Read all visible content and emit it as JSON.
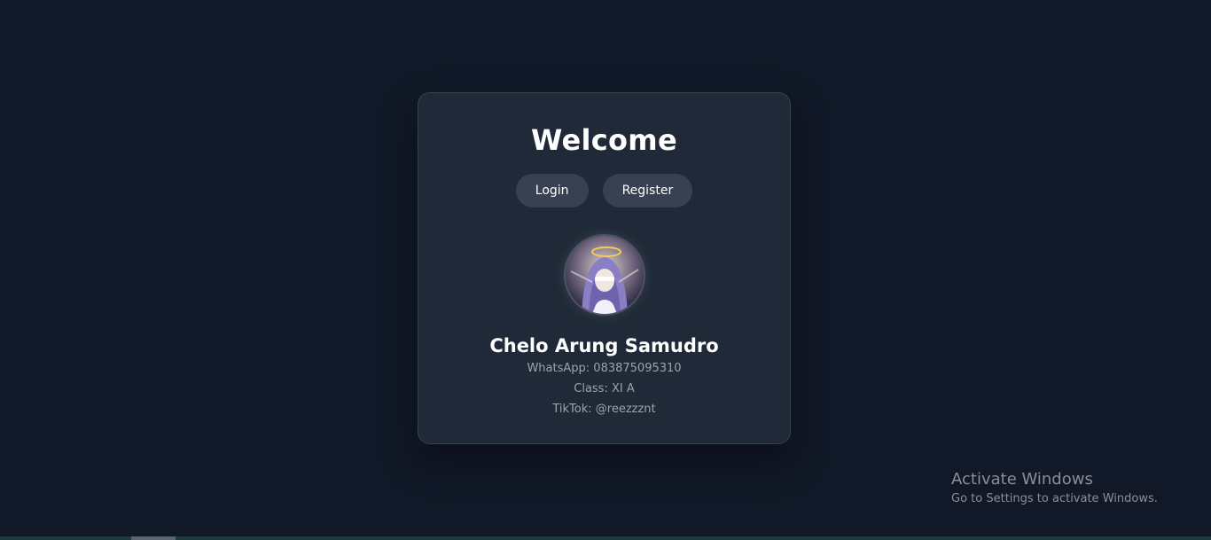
{
  "card": {
    "title": "Welcome",
    "login_label": "Login",
    "register_label": "Register"
  },
  "profile": {
    "name": "Chelo Arung Samudro",
    "whatsapp": "WhatsApp: 083875095310",
    "class": "Class: XI A",
    "tiktok": "TikTok: @reezzznt"
  },
  "windows_watermark": {
    "title": "Activate Windows",
    "subtitle": "Go to Settings to activate Windows."
  },
  "colors": {
    "background": "#111827",
    "card": "#1f2937",
    "button": "#374151",
    "text_primary": "#ffffff",
    "text_muted": "#9ca3af"
  }
}
